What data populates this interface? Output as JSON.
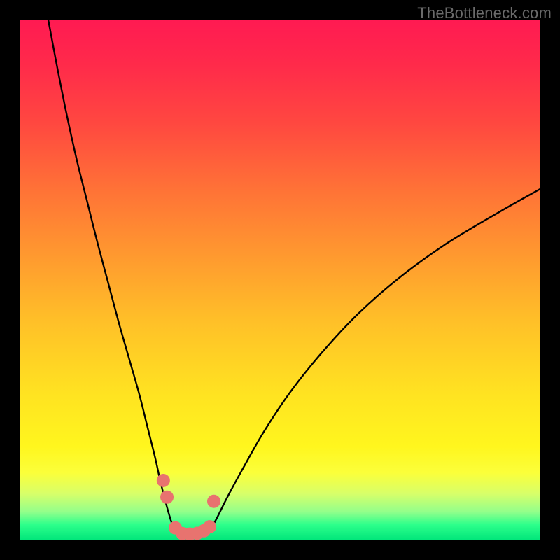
{
  "watermark": "TheBottleneck.com",
  "colors": {
    "curve_stroke": "#000000",
    "marker_fill": "#e8736f",
    "marker_stroke": "#e8736f"
  },
  "chart_data": {
    "type": "line",
    "title": "",
    "xlabel": "",
    "ylabel": "",
    "xlim": [
      0,
      100
    ],
    "ylim": [
      0,
      100
    ],
    "series": [
      {
        "name": "left-branch",
        "x": [
          5.5,
          7,
          9,
          11,
          13,
          15,
          17,
          19,
          21,
          23,
          24.5,
          26,
          27,
          28,
          29,
          29.7
        ],
        "y": [
          100,
          92,
          82,
          73,
          65,
          57,
          49.5,
          42,
          35,
          28,
          22,
          16,
          11.5,
          7.5,
          4,
          2
        ]
      },
      {
        "name": "trough",
        "x": [
          29.7,
          30.5,
          31.5,
          32.5,
          33.5,
          34.5,
          35.5,
          36.7
        ],
        "y": [
          2,
          1.1,
          0.8,
          0.75,
          0.78,
          0.95,
          1.3,
          2.1
        ]
      },
      {
        "name": "right-branch",
        "x": [
          36.7,
          38,
          40,
          43,
          47,
          52,
          58,
          65,
          73,
          82,
          92,
          100
        ],
        "y": [
          2.1,
          4.5,
          8.5,
          14,
          21,
          28.5,
          36,
          43.5,
          50.5,
          57,
          63,
          67.5
        ]
      }
    ],
    "markers": {
      "name": "highlighted-points",
      "points": [
        {
          "x": 27.6,
          "y": 11.5
        },
        {
          "x": 28.3,
          "y": 8.3
        },
        {
          "x": 29.9,
          "y": 2.4
        },
        {
          "x": 31.3,
          "y": 1.3
        },
        {
          "x": 32.7,
          "y": 1.2
        },
        {
          "x": 34.1,
          "y": 1.35
        },
        {
          "x": 35.4,
          "y": 1.85
        },
        {
          "x": 36.5,
          "y": 2.6
        },
        {
          "x": 37.3,
          "y": 7.5
        }
      ],
      "radius_px": 9
    }
  }
}
